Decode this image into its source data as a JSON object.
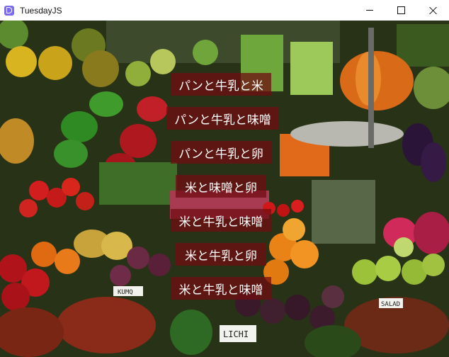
{
  "window": {
    "title": "TuesdayJS",
    "icon": "tuesdayjs-app-icon",
    "controls": [
      "minimize-icon",
      "maximize-icon",
      "close-icon"
    ]
  },
  "background": {
    "image": "market-produce-photo",
    "signs": [
      "KUMQ",
      "LICHI",
      "SALAD"
    ]
  },
  "menu": {
    "items": [
      {
        "label": "パンと牛乳と米"
      },
      {
        "label": "パンと牛乳と味噌"
      },
      {
        "label": "パンと牛乳と卵"
      },
      {
        "label": "米と味噌と卵"
      },
      {
        "label": "米と牛乳と味噌"
      },
      {
        "label": "米と牛乳と卵"
      },
      {
        "label": "米と牛乳と味噌"
      }
    ],
    "item_bg": "#700c12"
  }
}
